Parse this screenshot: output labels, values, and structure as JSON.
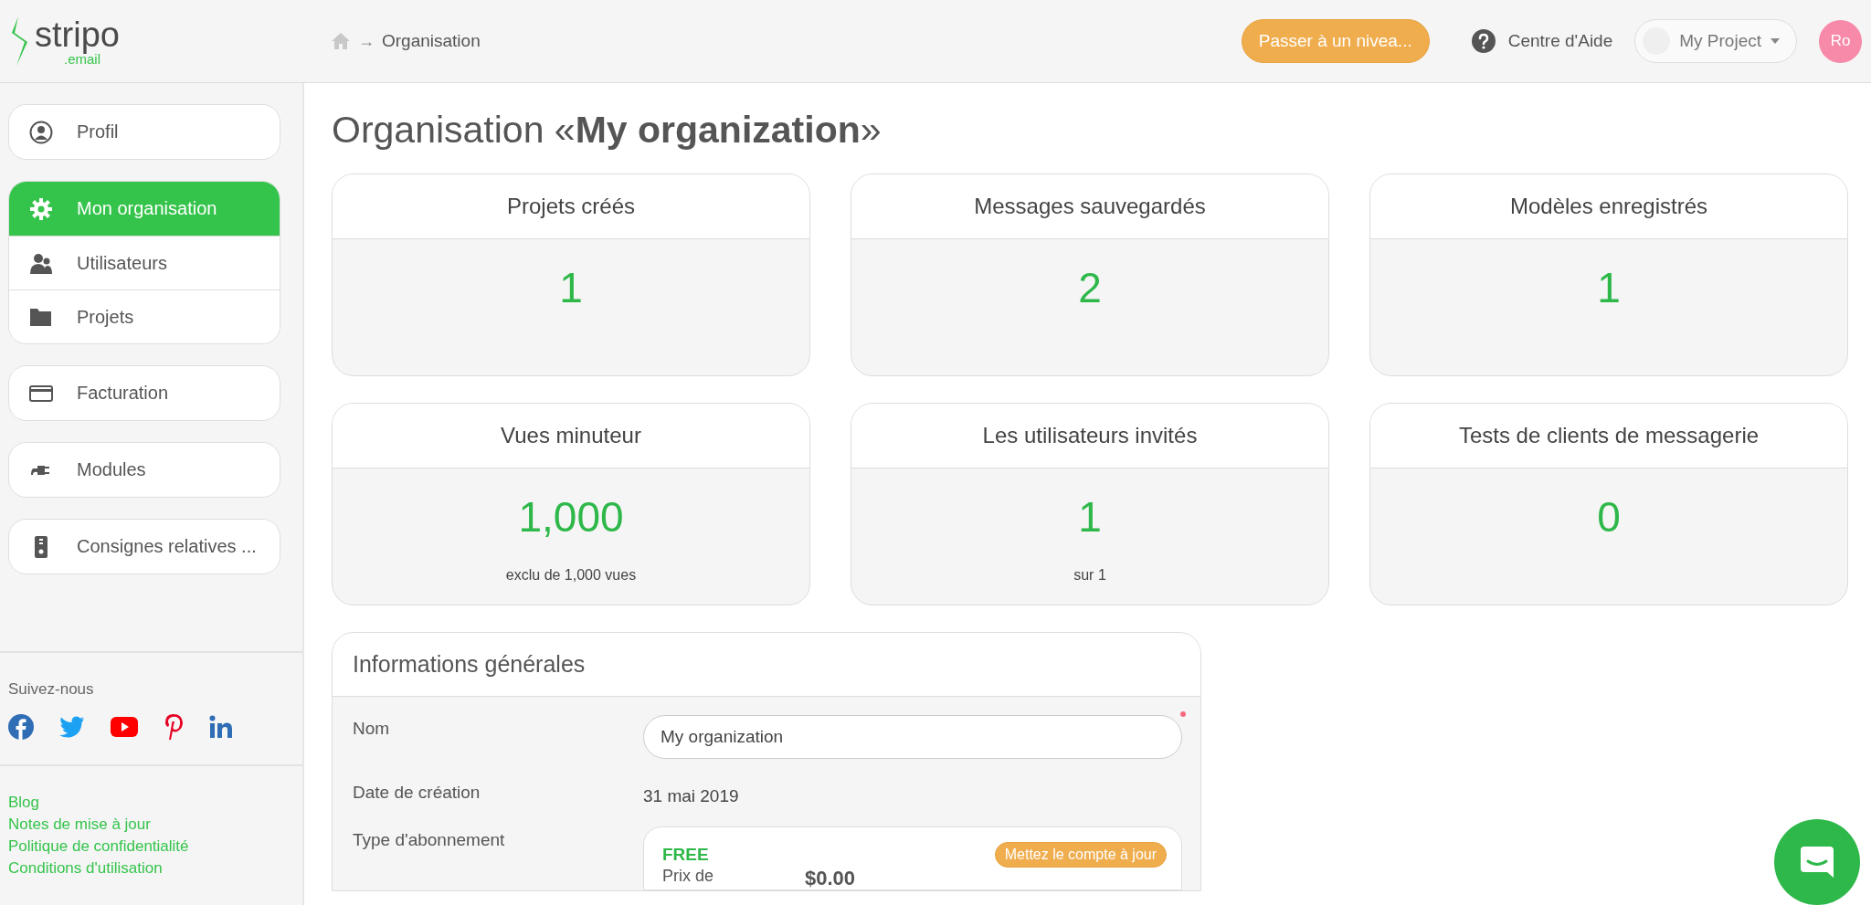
{
  "header": {
    "logo": {
      "name": "stripo",
      "suffix": ".email"
    },
    "breadcrumb": {
      "separator": "→",
      "current": "Organisation"
    },
    "upgrade_button": "Passer à un nivea...",
    "help": "Centre d'Aide",
    "project_select": "My Project",
    "avatar": "Ro"
  },
  "sidebar": {
    "groups": [
      {
        "items": [
          {
            "label": "Profil",
            "selected": false
          }
        ]
      },
      {
        "items": [
          {
            "label": "Mon organisation",
            "selected": true
          },
          {
            "label": "Utilisateurs",
            "selected": false
          },
          {
            "label": "Projets",
            "selected": false
          }
        ]
      },
      {
        "items": [
          {
            "label": "Facturation",
            "selected": false
          }
        ]
      },
      {
        "items": [
          {
            "label": "Modules",
            "selected": false
          }
        ]
      },
      {
        "items": [
          {
            "label": "Consignes relatives ...",
            "selected": false
          }
        ]
      }
    ],
    "follow_label": "Suivez-nous",
    "links": [
      "Blog",
      "Notes de mise à jour",
      "Politique de confidentialité",
      "Conditions d'utilisation"
    ]
  },
  "main": {
    "title": "Organisation «**My organization**»",
    "stats": [
      {
        "title": "Projets créés",
        "value": "1"
      },
      {
        "title": "Messages sauvegardés",
        "value": "2"
      },
      {
        "title": "Modèles enregistrés",
        "value": "1"
      },
      {
        "title": "Vues minuteur",
        "value": "1,000",
        "note": "exclu de 1,000 vues"
      },
      {
        "title": "Les utilisateurs invités",
        "value": "1",
        "note": "sur 1"
      },
      {
        "title": "Tests de clients de messagerie",
        "value": "0"
      }
    ],
    "info": {
      "title": "Informations générales",
      "name_label": "Nom",
      "name_value": "My organization",
      "date_label": "Date de création",
      "date_value": "31 mai 2019",
      "plan_label": "Type d'abonnement",
      "plan": {
        "name": "FREE",
        "upgrade": "Mettez le compte à jour",
        "price_label": "Prix de",
        "price_value": "$0.00"
      }
    }
  }
}
